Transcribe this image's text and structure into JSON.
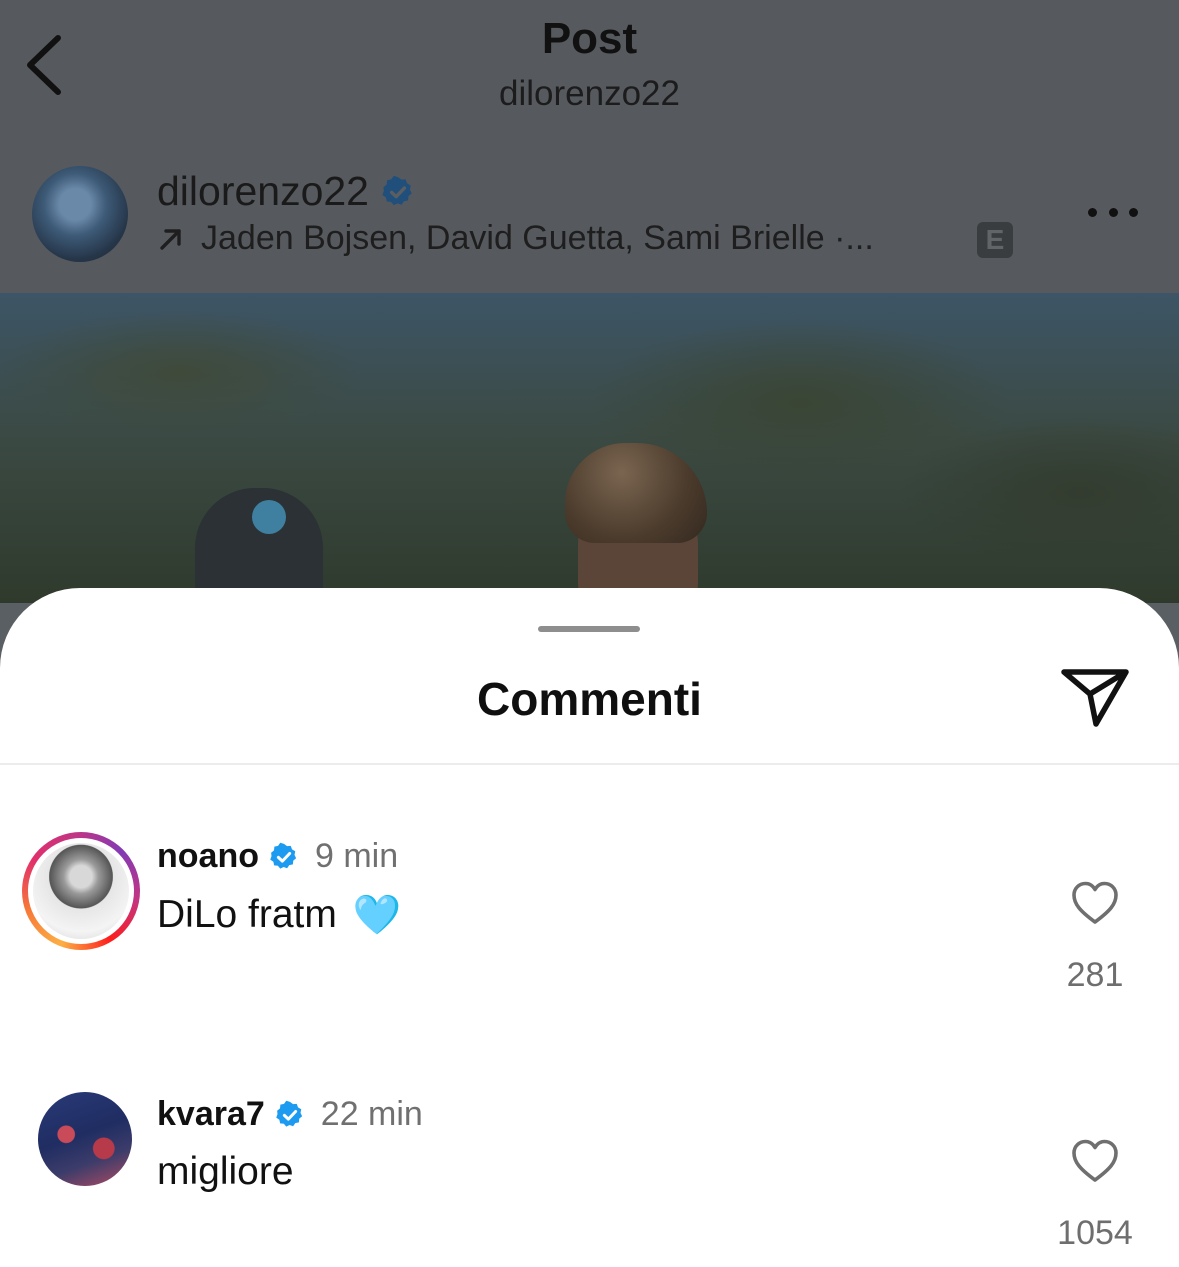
{
  "header": {
    "title": "Post",
    "subtitle": "dilorenzo22"
  },
  "post": {
    "owner": "dilorenzo22",
    "collaborators": "Jaden Bojsen, David Guetta, Sami Brielle ·...",
    "explicit_badge": "E",
    "icons": [
      "back-chevron-icon",
      "verified-icon",
      "arrow-up-right-icon",
      "more-icon"
    ]
  },
  "comments_sheet": {
    "title": "Commenti",
    "items": [
      {
        "username": "noano",
        "time": "9 min",
        "text": "DiLo fratm",
        "emoji": "🩵",
        "likes": "281"
      },
      {
        "username": "kvara7",
        "time": "22 min",
        "text": "migliore",
        "likes": "1054"
      }
    ]
  },
  "colors": {
    "verified_blue": "#1d9bf0",
    "overlay": "#565a5e"
  }
}
